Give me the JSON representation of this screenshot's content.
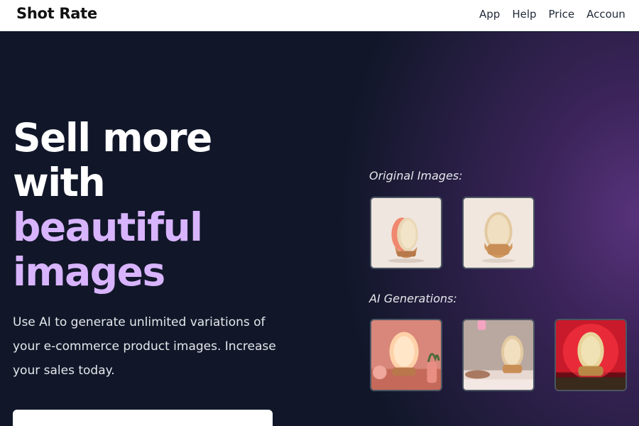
{
  "header": {
    "brand": "Shot Rate",
    "nav": [
      "App",
      "Help",
      "Price",
      "Accoun"
    ]
  },
  "hero": {
    "headline_white": [
      "Sell more",
      "with"
    ],
    "headline_accent": [
      "beautiful",
      "images"
    ],
    "subtext": "Use AI to generate unlimited variations of your e-commerce product images. Increase your sales today."
  },
  "gallery": {
    "original_label": "Original Images:",
    "ai_label": "AI Generations:",
    "original_thumbs": [
      "lamp-side-view-image",
      "lamp-front-view-image"
    ],
    "ai_thumbs": [
      "lamp-pink-scene-image",
      "lamp-bedroom-scene-image",
      "lamp-red-scene-image"
    ]
  },
  "colors": {
    "accent": "#d8b4fe",
    "background": "#111729",
    "gradient": "#5c3480"
  }
}
